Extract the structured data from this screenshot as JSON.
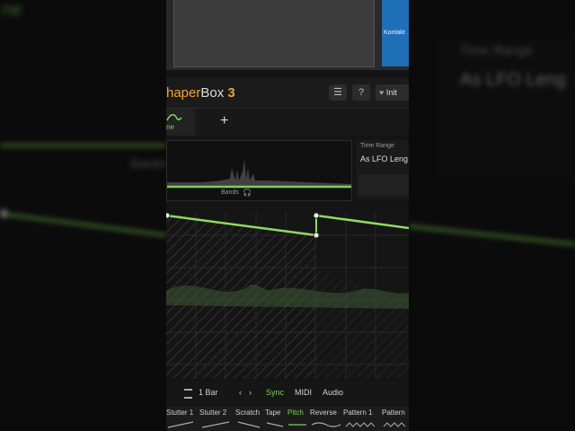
{
  "brand": {
    "name_part1": "haper",
    "name_part2": "Box",
    "version": "3"
  },
  "host": {
    "kontakt_label": "Kontakt"
  },
  "header": {
    "menu_icon": "menu-icon",
    "help_icon": "help-icon",
    "preset_prefix": "Init"
  },
  "tabs": {
    "active_label": "ne",
    "add_label": "+"
  },
  "bands": {
    "label": "Bands"
  },
  "time_range": {
    "label": "Time Range",
    "value": "As LFO Leng"
  },
  "bottom_bar": {
    "length": "1 Bar",
    "prev": "‹",
    "next": "›",
    "sync": "Sync",
    "midi": "MIDI",
    "audio": "Audio"
  },
  "preset_bar": {
    "items": [
      {
        "label": "Stutter 1",
        "active": false
      },
      {
        "label": "Stutter 2",
        "active": false
      },
      {
        "label": "Scratch",
        "active": false
      },
      {
        "label": "Tape",
        "active": false
      },
      {
        "label": "Pitch",
        "active": true
      },
      {
        "label": "Reverse",
        "active": false
      },
      {
        "label": "Pattern 1",
        "active": false
      },
      {
        "label": "Pattern",
        "active": false
      }
    ]
  },
  "background": {
    "top_left": "ne",
    "bands": "Bands",
    "time_range_label": "Time Range",
    "time_range_value": "As LFO Leng"
  },
  "colors": {
    "accent_green": "#7ccf54",
    "brand_orange": "#f0a530",
    "kontakt_blue": "#1e6fb5"
  }
}
